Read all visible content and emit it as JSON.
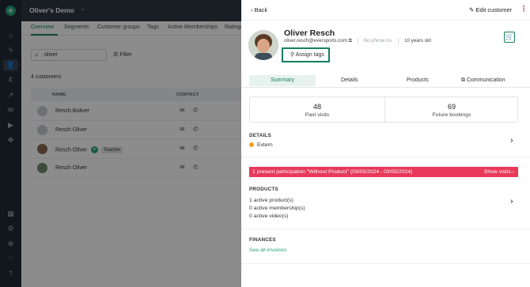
{
  "app": {
    "title": "Oliver's Demo"
  },
  "background_tabs": [
    "Overview",
    "Segments",
    "Customer groups",
    "Tags",
    "Active Memberships",
    "Ratings"
  ],
  "search": {
    "value": "oliver"
  },
  "filter_label": "Filter",
  "customer_count": "4 customers",
  "table": {
    "headers": [
      "NAME",
      "CONTACT"
    ],
    "rows": [
      {
        "name": "Resch Boliver"
      },
      {
        "name": "Resch Oliver"
      },
      {
        "name": "Resch Oliver",
        "badge": "Teacher"
      },
      {
        "name": "Resch Oliver"
      }
    ]
  },
  "panel": {
    "back_label": "Back",
    "edit_label": "Edit customer",
    "customer": {
      "name": "Oliver Resch",
      "email": "oliver.resch@eversports.com",
      "phone": "No phone no.",
      "age": "10 years old"
    },
    "assign_tags_label": "Assign tags",
    "tabs": [
      "Summary",
      "Details",
      "Products",
      "Communication"
    ],
    "stats": [
      {
        "value": "48",
        "label": "Past visits"
      },
      {
        "value": "69",
        "label": "Future bookings"
      }
    ],
    "details": {
      "heading": "DETAILS",
      "status": "Extern"
    },
    "alert": {
      "text": "1 present participation \"Without Product\" (03/05/2024 - 03/05/2024)",
      "action": "Show visits"
    },
    "products": {
      "heading": "PRODUCTS",
      "lines": [
        "1 active product(s)",
        "0 active membership(s)",
        "0 active video(s)"
      ]
    },
    "finances": {
      "heading": "FINANCES",
      "link": "See all invoices"
    }
  },
  "colors": {
    "accent": "#157e5f",
    "alert": "#e8395a",
    "status_dot": "#f0a020"
  }
}
